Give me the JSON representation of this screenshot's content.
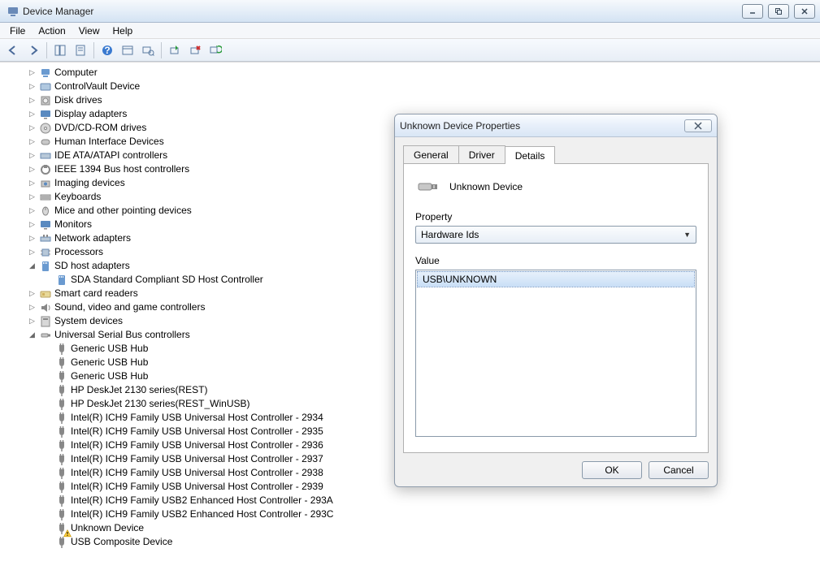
{
  "window": {
    "title": "Device Manager"
  },
  "menus": {
    "file": "File",
    "action": "Action",
    "view": "View",
    "help": "Help"
  },
  "tree": {
    "categories": [
      {
        "label": "Computer",
        "icon": "pc"
      },
      {
        "label": "ControlVault Device",
        "icon": "card"
      },
      {
        "label": "Disk drives",
        "icon": "disk"
      },
      {
        "label": "Display adapters",
        "icon": "display"
      },
      {
        "label": "DVD/CD-ROM drives",
        "icon": "cd"
      },
      {
        "label": "Human Interface Devices",
        "icon": "hid"
      },
      {
        "label": "IDE ATA/ATAPI controllers",
        "icon": "ide"
      },
      {
        "label": "IEEE 1394 Bus host controllers",
        "icon": "1394"
      },
      {
        "label": "Imaging devices",
        "icon": "imaging"
      },
      {
        "label": "Keyboards",
        "icon": "keyboard"
      },
      {
        "label": "Mice and other pointing devices",
        "icon": "mouse"
      },
      {
        "label": "Monitors",
        "icon": "monitor"
      },
      {
        "label": "Network adapters",
        "icon": "net"
      },
      {
        "label": "Processors",
        "icon": "cpu"
      }
    ],
    "sd": {
      "label": "SD host adapters",
      "children": [
        {
          "label": "SDA Standard Compliant SD Host Controller"
        }
      ]
    },
    "after_sd": [
      {
        "label": "Smart card readers",
        "icon": "smartcard"
      },
      {
        "label": "Sound, video and game controllers",
        "icon": "sound"
      },
      {
        "label": "System devices",
        "icon": "system"
      }
    ],
    "usb": {
      "label": "Universal Serial Bus controllers",
      "children": [
        {
          "label": "Generic USB Hub"
        },
        {
          "label": "Generic USB Hub"
        },
        {
          "label": "Generic USB Hub"
        },
        {
          "label": "HP DeskJet 2130 series(REST)"
        },
        {
          "label": "HP DeskJet 2130 series(REST_WinUSB)"
        },
        {
          "label": "Intel(R) ICH9 Family USB Universal Host Controller - 2934"
        },
        {
          "label": "Intel(R) ICH9 Family USB Universal Host Controller - 2935"
        },
        {
          "label": "Intel(R) ICH9 Family USB Universal Host Controller - 2936"
        },
        {
          "label": "Intel(R) ICH9 Family USB Universal Host Controller - 2937"
        },
        {
          "label": "Intel(R) ICH9 Family USB Universal Host Controller - 2938"
        },
        {
          "label": "Intel(R) ICH9 Family USB Universal Host Controller - 2939"
        },
        {
          "label": "Intel(R) ICH9 Family USB2 Enhanced Host Controller - 293A"
        },
        {
          "label": "Intel(R) ICH9 Family USB2 Enhanced Host Controller - 293C"
        },
        {
          "label": "Unknown Device",
          "warn": true
        },
        {
          "label": "USB Composite Device"
        }
      ]
    }
  },
  "dialog": {
    "title": "Unknown Device Properties",
    "tabs": {
      "general": "General",
      "driver": "Driver",
      "details": "Details"
    },
    "device_name": "Unknown Device",
    "property_label": "Property",
    "property_value": "Hardware Ids",
    "value_label": "Value",
    "value_items": [
      "USB\\UNKNOWN"
    ],
    "ok": "OK",
    "cancel": "Cancel"
  }
}
